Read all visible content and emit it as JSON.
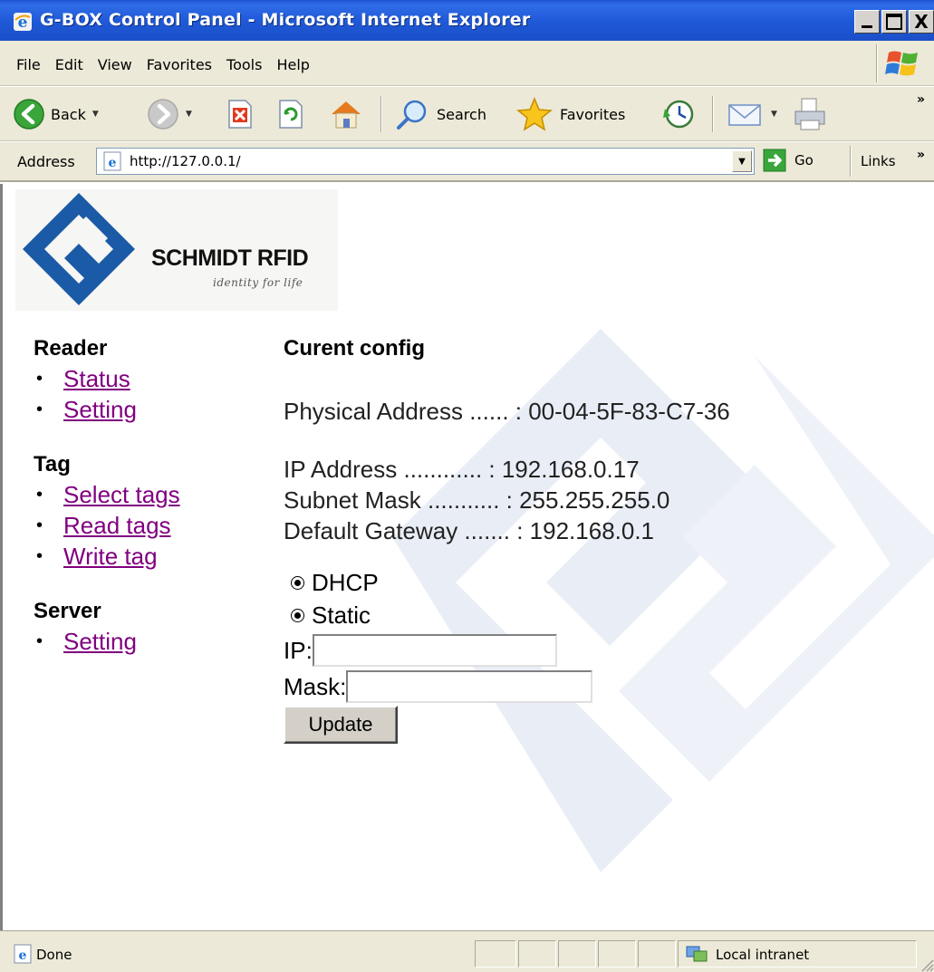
{
  "window": {
    "title": "G-BOX Control Panel - Microsoft Internet Explorer",
    "close_glyph": "X"
  },
  "menu": [
    "File",
    "Edit",
    "View",
    "Favorites",
    "Tools",
    "Help"
  ],
  "toolbar": {
    "back_label": "Back",
    "search_label": "Search",
    "favorites_label": "Favorites",
    "more_glyph": "»"
  },
  "address_bar": {
    "label": "Address",
    "url": "http://127.0.0.1/",
    "go_label": "Go",
    "links_label": "Links",
    "more_glyph": "»"
  },
  "logo": {
    "brand": "SCHMIDT RFID",
    "tagline": "identity for life"
  },
  "sidebar": [
    {
      "heading": "Reader",
      "links": [
        "Status",
        "Setting"
      ]
    },
    {
      "heading": "Tag",
      "links": [
        "Select tags",
        "Read tags",
        "Write tag"
      ]
    },
    {
      "heading": "Server",
      "links": [
        "Setting"
      ]
    }
  ],
  "config": {
    "heading": "Curent config",
    "physical_address": "Physical Address ...... : 00-04-5F-83-C7-36",
    "ip_address": "IP Address ............ : 192.168.0.17",
    "subnet_mask": "Subnet Mask ........... : 255.255.255.0",
    "default_gateway": "Default Gateway ....... : 192.168.0.1"
  },
  "form": {
    "dhcp_label": "DHCP",
    "static_label": "Static",
    "ip_label": "IP:",
    "ip_value": "",
    "mask_label": "Mask:",
    "mask_value": "",
    "update_label": "Update"
  },
  "status_bar": {
    "text": "Done",
    "zone": "Local intranet"
  },
  "colors": {
    "title_bar": "#1f58d6",
    "chrome": "#ece9d8",
    "visited_link": "#800080",
    "logo_blue": "#1b5aa6",
    "watermark": "#e9eef6"
  },
  "icons": [
    "ie-icon",
    "windows-logo-icon",
    "back-icon",
    "forward-icon",
    "stop-icon",
    "refresh-icon",
    "home-icon",
    "search-icon",
    "favorites-star-icon",
    "history-icon",
    "mail-icon",
    "print-icon",
    "page-icon",
    "go-arrow-icon",
    "local-intranet-icon"
  ]
}
